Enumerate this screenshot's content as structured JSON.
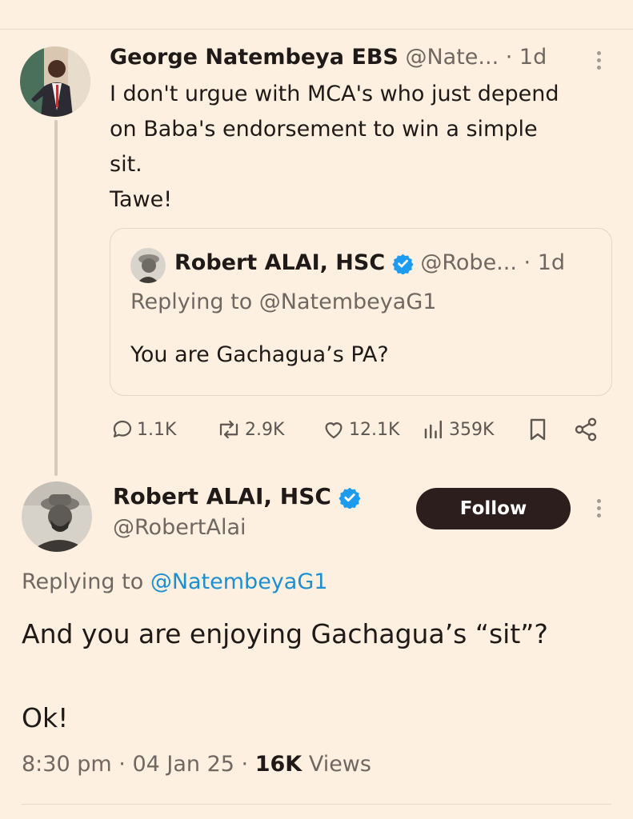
{
  "first_tweet": {
    "author_name": "George Natembeya EBS",
    "handle": "@Nate...",
    "time": "· 1d",
    "text_lines": [
      "I don't urgue with MCA's who just depend",
      "on Baba's endorsement to win a simple",
      "sit.",
      "Tawe!"
    ]
  },
  "quoted_tweet": {
    "author_name": "Robert ALAI, HSC",
    "handle": "@Robe...",
    "time": "· 1d",
    "replying_to": "Replying to @NatembeyaG1",
    "text": "You are Gachagua’s PA?"
  },
  "actions": {
    "replies": "1.1K",
    "reposts": "2.9K",
    "likes": "12.1K",
    "views": "359K"
  },
  "main_tweet": {
    "author_name": "Robert ALAI, HSC",
    "handle": "@RobertAlai",
    "follow_label": "Follow",
    "replying_prefix": "Replying to ",
    "replying_handle": "@NatembeyaG1",
    "text_line1": "And you are enjoying Gachagua’s “sit”?",
    "text_line2": "Ok!",
    "time": "8:30 pm",
    "date": "04 Jan 25",
    "views_count": "16K",
    "views_label": "Views"
  },
  "colors": {
    "background": "#fdf0e1",
    "verified": "#1d9bf0",
    "link": "#1d8fd1",
    "follow_bg": "#2b1e1d"
  },
  "icons": [
    "reply-icon",
    "repost-icon",
    "like-icon",
    "views-icon",
    "bookmark-icon",
    "share-icon",
    "verified-icon",
    "more-icon"
  ]
}
